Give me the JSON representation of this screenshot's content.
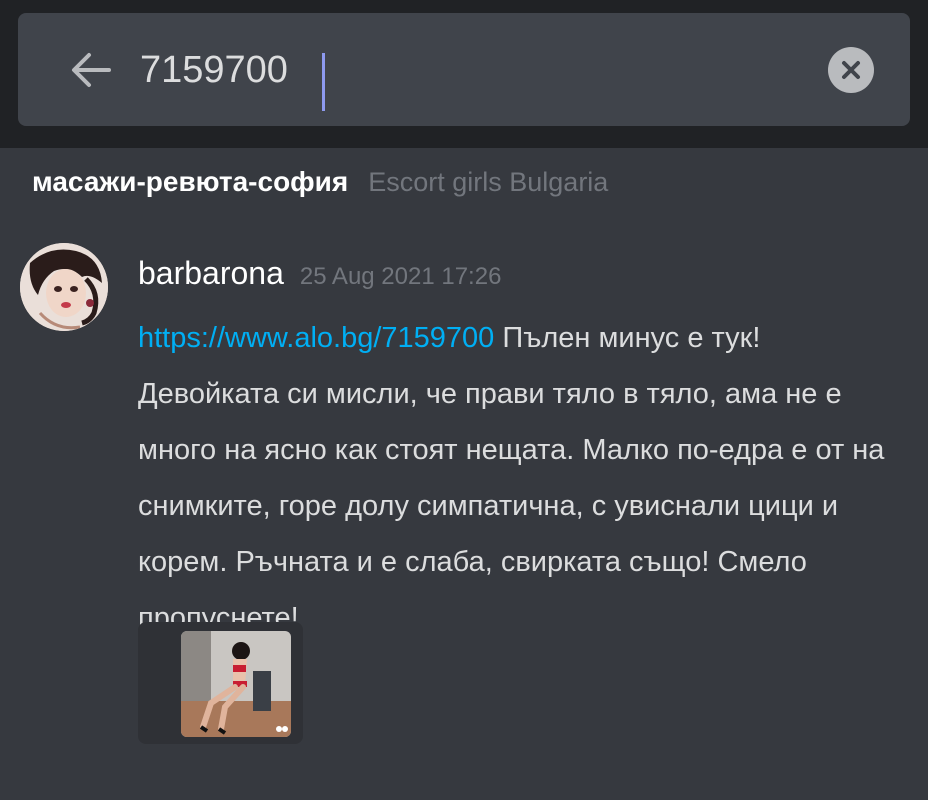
{
  "search": {
    "value": "7159700",
    "back_icon": "arrow-left-icon",
    "clear_icon": "close-circle-icon"
  },
  "channel": {
    "name": "масажи-ревюта-софия",
    "server": "Escort girls Bulgaria"
  },
  "message": {
    "author": "barbarona",
    "timestamp": "25 Aug 2021 17:26",
    "link_text": "https://www.alo.bg/7159700",
    "text": " Пълен минус е тук! Девойката си мисли, че прави тяло в тяло, ама не е много на ясно как стоят нещата. Малко по-едра е от на снимките, горе долу симпатична, с увиснали цици и корем. Ръчната и е слаба, свирката също! Смело пропуснете!"
  },
  "colors": {
    "background": "#36393f",
    "topbar": "#202225",
    "searchbox": "#40444b",
    "link": "#00aff4",
    "caret": "#8e9aef"
  }
}
